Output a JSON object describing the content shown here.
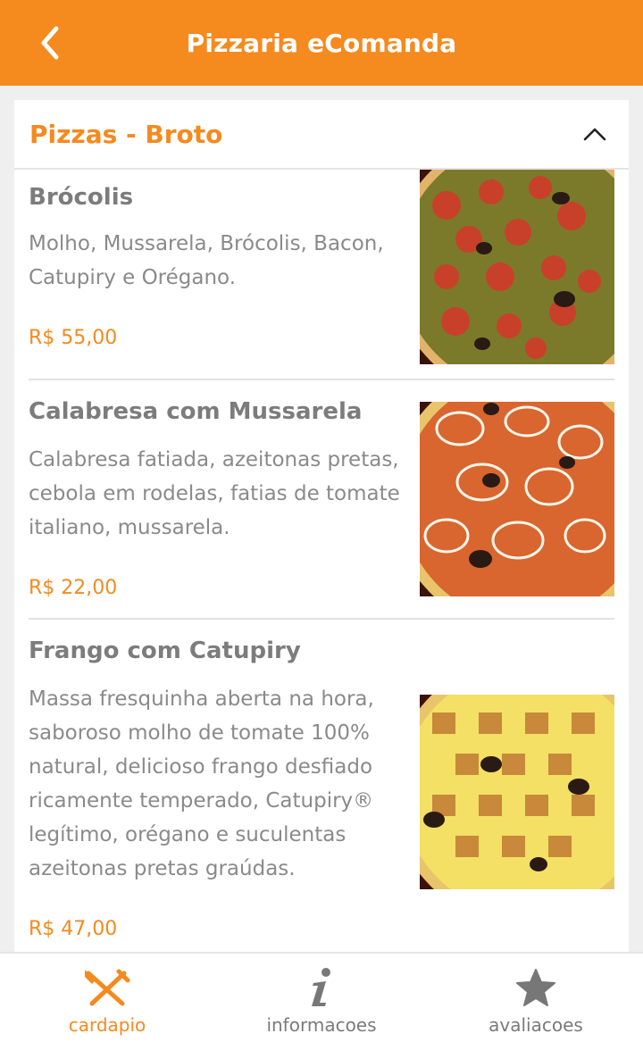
{
  "app_bar": {
    "title": "Pizzaria eComanda",
    "back_icon": "chevron-left-icon"
  },
  "section": {
    "title": "Pizzas - Broto",
    "collapse_icon": "chevron-up-icon"
  },
  "items": [
    {
      "name": "Brócolis",
      "description": "Molho, Mussarela, Brócolis, Bacon, Catupiry e Orégano.",
      "price": "R$ 55,00"
    },
    {
      "name": "Calabresa com Mussarela",
      "description": "Calabresa fatiada, azeitonas pretas, cebola em rodelas, fatias de tomate italiano, mussarela.",
      "price": "R$ 22,00"
    },
    {
      "name": "Frango com Catupiry",
      "description": "Massa fresquinha aberta na hora, saboroso molho de tomate 100% natural, delicioso frango desfiado ricamente temperado, Catupiry® legítimo, orégano e suculentas azeitonas pretas graúdas.",
      "price": "R$ 47,00"
    }
  ],
  "bottom_nav": [
    {
      "label": "cardapio",
      "icon": "fork-knife-icon",
      "active": true
    },
    {
      "label": "informacoes",
      "icon": "info-icon",
      "active": false
    },
    {
      "label": "avaliacoes",
      "icon": "star-icon",
      "active": false
    }
  ],
  "colors": {
    "accent": "#f58a1f",
    "text_gray": "#7c7c7c",
    "background": "#efefef"
  }
}
